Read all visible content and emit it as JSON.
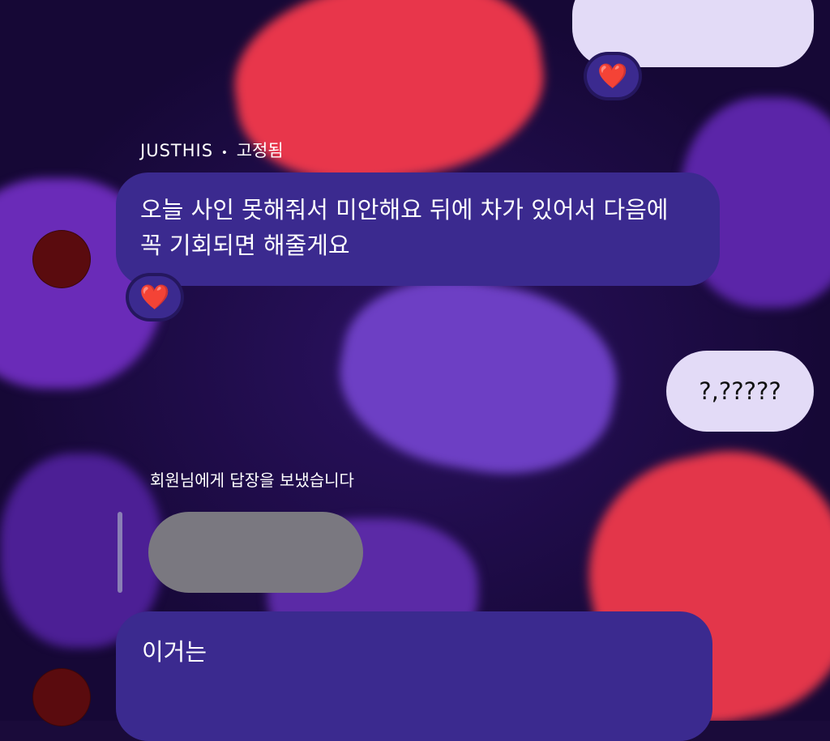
{
  "pinned_message": {
    "sender": "JUSTHIS",
    "separator": "•",
    "pinned_label": "고정됨",
    "text": "오늘 사인 못해줘서 미안해요 뒤에 차가 있어서 다음에 꼭 기회되면 해줄게요",
    "reaction": "❤️"
  },
  "top_outgoing": {
    "reaction": "❤️"
  },
  "outgoing_message": {
    "text": "?,?????"
  },
  "reply_context": {
    "status": "회원님에게 답장을 보냈습니다"
  },
  "incoming_message": {
    "text": "이거는"
  },
  "colors": {
    "incoming_bubble": "#3b2a8f",
    "outgoing_bubble": "#e3dbf7",
    "quoted_bubble": "#7a7880",
    "avatar": "#5a0b0e",
    "reaction_heart": "#ff3b4e"
  }
}
